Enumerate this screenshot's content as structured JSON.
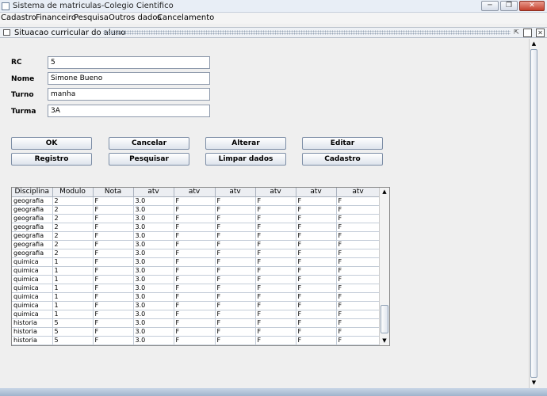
{
  "window": {
    "title": "Sistema de matriculas-Colegio Cientifico"
  },
  "menu": [
    "Cadastro",
    "Financeiro",
    "Pesquisa",
    "Outros dados",
    "Cancelamento"
  ],
  "frame": {
    "title": "Situacao curricular do aluno"
  },
  "form": {
    "rc": {
      "label": "RC",
      "value": "5"
    },
    "nome": {
      "label": "Nome",
      "value": "Simone Bueno"
    },
    "turno": {
      "label": "Turno",
      "value": "manha"
    },
    "turma": {
      "label": "Turma",
      "value": "3A"
    }
  },
  "buttons": {
    "ok": "OK",
    "cancelar": "Cancelar",
    "alterar": "Alterar",
    "editar": "Editar",
    "registro": "Registro",
    "pesquisar": "Pesquisar",
    "limpar": "Limpar dados",
    "cadastro": "Cadastro"
  },
  "table": {
    "headers": [
      "Disciplina",
      "Modulo",
      "Nota",
      "atv",
      "atv",
      "atv",
      "atv",
      "atv",
      "atv"
    ],
    "rows": [
      [
        "geografia",
        "2",
        "F",
        "3.0",
        "F",
        "F",
        "F",
        "F",
        "F"
      ],
      [
        "geografia",
        "2",
        "F",
        "3.0",
        "F",
        "F",
        "F",
        "F",
        "F"
      ],
      [
        "geografia",
        "2",
        "F",
        "3.0",
        "F",
        "F",
        "F",
        "F",
        "F"
      ],
      [
        "geografia",
        "2",
        "F",
        "3.0",
        "F",
        "F",
        "F",
        "F",
        "F"
      ],
      [
        "geografia",
        "2",
        "F",
        "3.0",
        "F",
        "F",
        "F",
        "F",
        "F"
      ],
      [
        "geografia",
        "2",
        "F",
        "3.0",
        "F",
        "F",
        "F",
        "F",
        "F"
      ],
      [
        "geografia",
        "2",
        "F",
        "3.0",
        "F",
        "F",
        "F",
        "F",
        "F"
      ],
      [
        "quimica",
        "1",
        "F",
        "3.0",
        "F",
        "F",
        "F",
        "F",
        "F"
      ],
      [
        "quimica",
        "1",
        "F",
        "3.0",
        "F",
        "F",
        "F",
        "F",
        "F"
      ],
      [
        "quimica",
        "1",
        "F",
        "3.0",
        "F",
        "F",
        "F",
        "F",
        "F"
      ],
      [
        "quimica",
        "1",
        "F",
        "3.0",
        "F",
        "F",
        "F",
        "F",
        "F"
      ],
      [
        "quimica",
        "1",
        "F",
        "3.0",
        "F",
        "F",
        "F",
        "F",
        "F"
      ],
      [
        "quimica",
        "1",
        "F",
        "3.0",
        "F",
        "F",
        "F",
        "F",
        "F"
      ],
      [
        "quimica",
        "1",
        "F",
        "3.0",
        "F",
        "F",
        "F",
        "F",
        "F"
      ],
      [
        "historia",
        "5",
        "F",
        "3.0",
        "F",
        "F",
        "F",
        "F",
        "F"
      ],
      [
        "historia",
        "5",
        "F",
        "3.0",
        "F",
        "F",
        "F",
        "F",
        "F"
      ],
      [
        "historia",
        "5",
        "F",
        "3.0",
        "F",
        "F",
        "F",
        "F",
        "F"
      ],
      [
        "historia",
        "5",
        "F",
        "",
        "F",
        "F",
        "F",
        "F",
        "F"
      ]
    ]
  },
  "icons": {
    "app": "window-icon",
    "minimize": "minimize-icon",
    "maximize": "maximize-icon",
    "close": "close-icon",
    "frame": "frame-icon",
    "scroll_up": "arrow-up-icon",
    "scroll_down": "arrow-down-icon"
  },
  "colors": {
    "title_bg": "#e8eef6",
    "close_button": "#c4412d",
    "table_grid": "#c3ccd8"
  }
}
